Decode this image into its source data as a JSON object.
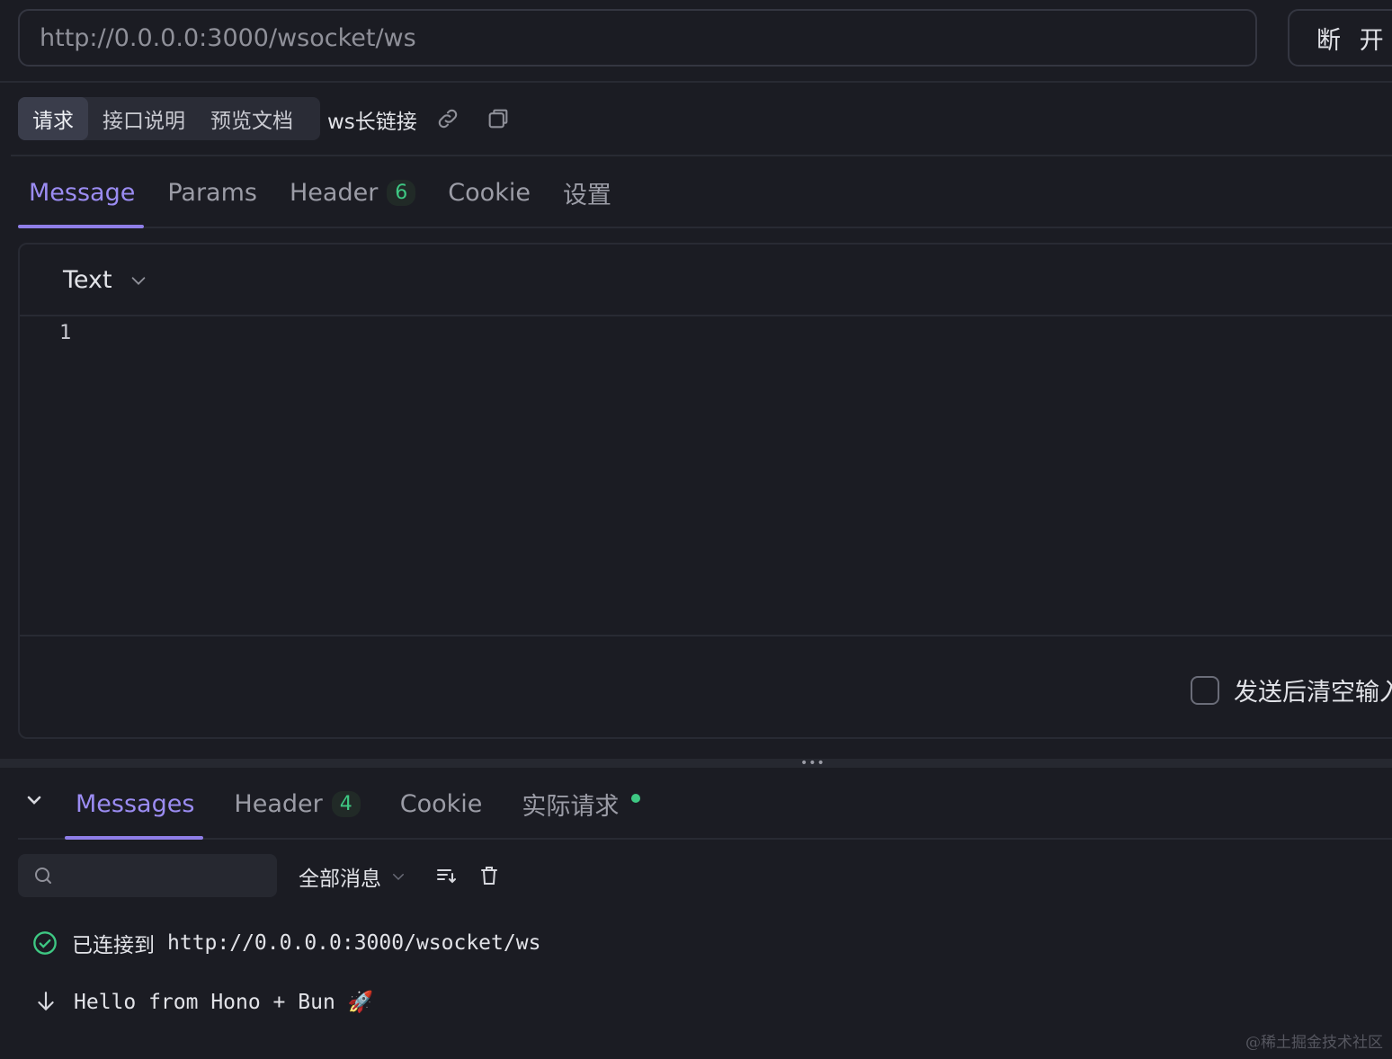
{
  "url_bar": {
    "url": "http://0.0.0.0:3000/wsocket/ws",
    "disconnect_label": "断 开"
  },
  "doc_tabs": {
    "items": [
      "请求",
      "接口说明",
      "预览文档"
    ],
    "active": "请求",
    "endpoint_name": "ws长链接"
  },
  "request_tabs": {
    "message": "Message",
    "params": "Params",
    "header": "Header",
    "header_count": "6",
    "cookie": "Cookie",
    "settings": "设置"
  },
  "editor": {
    "format": "Text",
    "line_number": "1",
    "clear_after_send_label": "发送后清空输入"
  },
  "response_tabs": {
    "messages": "Messages",
    "header": "Header",
    "header_count": "4",
    "cookie": "Cookie",
    "actual_request": "实际请求"
  },
  "log_toolbar": {
    "search_placeholder": "",
    "filter_label": "全部消息"
  },
  "log": {
    "connected_prefix": "已连接到",
    "connected_url": "http://0.0.0.0:3000/wsocket/ws",
    "received_message": "Hello from Hono + Bun 🚀"
  },
  "watermark": "@稀土掘金技术社区",
  "colors": {
    "accent": "#9b8cf2",
    "success": "#3ec883",
    "background": "#1b1c23"
  }
}
